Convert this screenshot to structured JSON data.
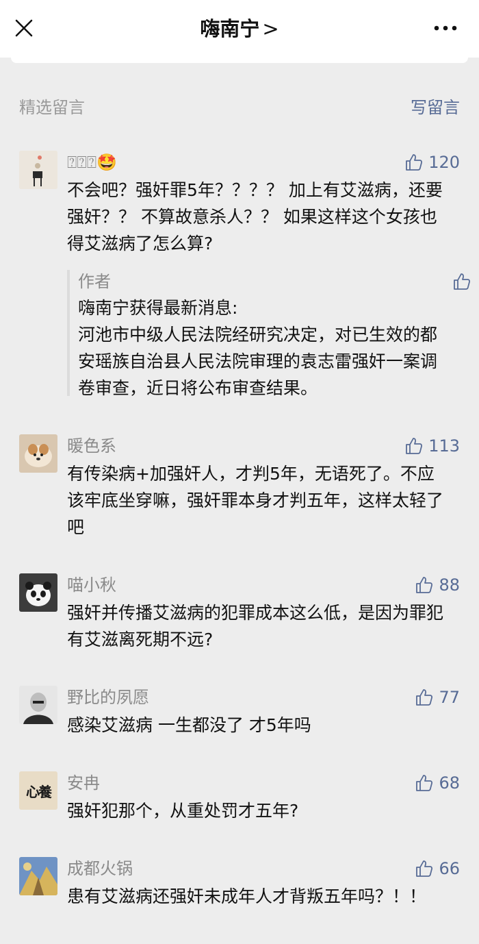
{
  "header": {
    "title": "嗨南宁",
    "chevron": ">"
  },
  "section": {
    "title": "精选留言",
    "write_label": "写留言"
  },
  "comments": [
    {
      "nickname": "⍰⍰⍰🤩",
      "likes": "120",
      "text": "不会吧？强奸罪5年？？？？ 加上有艾滋病，还要强奸？？ 不算故意杀人？？ 如果这样这个女孩也得艾滋病了怎么算?",
      "reply": {
        "author": "作者",
        "text": "嗨南宁获得最新消息:\n河池市中级人民法院经研究决定，对已生效的都安瑶族自治县人民法院审理的袁志雷强奸一案调卷审查，近日将公布审查结果。"
      }
    },
    {
      "nickname": "暖色系",
      "likes": "113",
      "text": "有传染病+加强奸人，才判5年，无语死了。不应该牢底坐穿嘛，强奸罪本身才判五年，这样太轻了吧"
    },
    {
      "nickname": "喵小秋",
      "likes": "88",
      "text": "强奸并传播艾滋病的犯罪成本这么低，是因为罪犯有艾滋离死期不远?"
    },
    {
      "nickname": "野比的夙愿",
      "likes": "77",
      "text": "感染艾滋病 一生都没了 才5年吗"
    },
    {
      "nickname": "安冉",
      "likes": "68",
      "text": "强奸犯那个，从重处罚才五年?",
      "avatar_text": "心養"
    },
    {
      "nickname": "成都火锅",
      "likes": "66",
      "text": "患有艾滋病还强奸未成年人才背叛五年吗？！！"
    }
  ],
  "colors": {
    "link": "#576b95",
    "muted": "#8a8a8a",
    "background": "#ededed"
  }
}
